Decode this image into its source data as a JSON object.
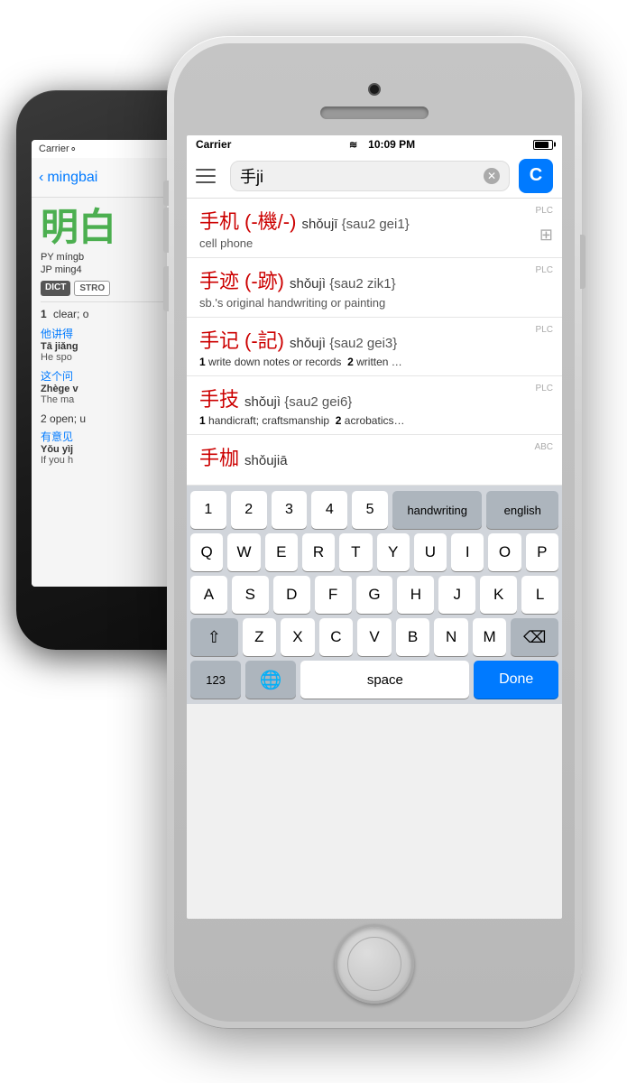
{
  "back_phone": {
    "carrier": "Carrier",
    "back_nav": "mingbai",
    "chinese_title": "明白",
    "py_label": "PY",
    "py_value": "míngb",
    "jp_label": "JP",
    "jp_value": "ming4",
    "badge_dict": "DICT",
    "badge_stro": "STRO",
    "def1_num": "1",
    "def1_text": "clear; o",
    "example1_zh": "他讲得",
    "example1_py": "Tā jiǎng",
    "example1_en": "He spo",
    "example2_zh": "这个问",
    "example2_py": "Zhège v",
    "example2_en": "The ma",
    "def2_num": "2",
    "def2_text": "open; u",
    "example3_zh": "有意见",
    "example3_py": "Yǒu yìj",
    "example3_en": "If you h"
  },
  "front_phone": {
    "carrier": "Carrier",
    "time": "10:09 PM",
    "search_text": "手ji",
    "search_btn_label": "C",
    "results": [
      {
        "chinese": "手机",
        "traditional": "(-機/-)",
        "pinyin": "shǒujī",
        "cantonese": "{sau2 gei1}",
        "english": "cell phone",
        "plc": "PLC",
        "has_add": true
      },
      {
        "chinese": "手迹",
        "traditional": "(-跡)",
        "pinyin": "shǒujì",
        "cantonese": "{sau2 zik1}",
        "english": "sb.'s original handwriting or painting",
        "plc": "PLC",
        "has_add": false
      },
      {
        "chinese": "手记",
        "traditional": "(-記)",
        "pinyin": "shǒujì",
        "cantonese": "{sau2 gei3}",
        "english": "1 write down notes or records  2 written …",
        "plc": "PLC",
        "has_add": false
      },
      {
        "chinese": "手技",
        "traditional": "",
        "pinyin": "shǒujì",
        "cantonese": "{sau2 gei6}",
        "english": "1 handicraft; craftsmanship  2 acrobatics…",
        "plc": "PLC",
        "has_add": false
      },
      {
        "chinese": "手枷",
        "traditional": "",
        "pinyin": "shǒujiā",
        "cantonese": "",
        "english": "",
        "plc": "ABC",
        "has_add": false
      }
    ],
    "keyboard": {
      "row_numbers": [
        "1",
        "2",
        "3",
        "4",
        "5"
      ],
      "handwriting_key": "handwriting",
      "english_key": "english",
      "row1": [
        "Q",
        "W",
        "E",
        "R",
        "T",
        "Y",
        "U",
        "I",
        "O",
        "P"
      ],
      "row2": [
        "A",
        "S",
        "D",
        "F",
        "G",
        "H",
        "J",
        "K",
        "L"
      ],
      "row3": [
        "Z",
        "X",
        "C",
        "V",
        "B",
        "N",
        "M"
      ],
      "shift_label": "⇧",
      "delete_label": "⌫",
      "num_label": "123",
      "globe_label": "🌐",
      "space_label": "space",
      "done_label": "Done"
    }
  }
}
